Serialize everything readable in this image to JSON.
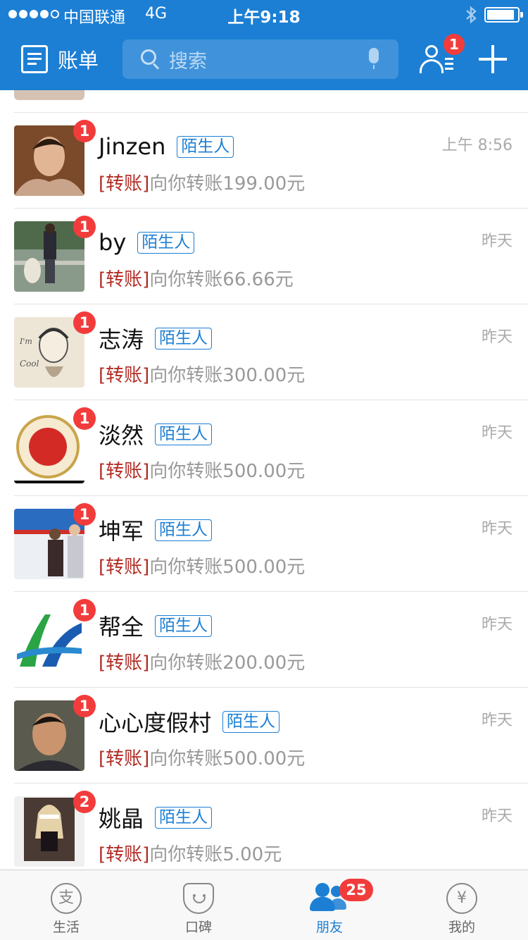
{
  "status_bar": {
    "carrier": "中国联通",
    "network": "4G",
    "time": "上午9:18",
    "bluetooth_icon": "bluetooth-icon",
    "battery_icon": "battery-icon"
  },
  "header": {
    "bill_label": "账单",
    "search_placeholder": "搜索",
    "contacts_badge": "1",
    "brand_color": "#1c7fd4"
  },
  "messages": [
    {
      "name": "Jinzen",
      "tag": "陌生人",
      "badge": "1",
      "kind": "[转账]",
      "text": "向你转账199.00元",
      "time": "上午 8:56"
    },
    {
      "name": "by",
      "tag": "陌生人",
      "badge": "1",
      "kind": "[转账]",
      "text": "向你转账66.66元",
      "time": "昨天"
    },
    {
      "name": "志涛",
      "tag": "陌生人",
      "badge": "1",
      "kind": "[转账]",
      "text": "向你转账300.00元",
      "time": "昨天"
    },
    {
      "name": "淡然",
      "tag": "陌生人",
      "badge": "1",
      "kind": "[转账]",
      "text": "向你转账500.00元",
      "time": "昨天"
    },
    {
      "name": "坤军",
      "tag": "陌生人",
      "badge": "1",
      "kind": "[转账]",
      "text": "向你转账500.00元",
      "time": "昨天"
    },
    {
      "name": "帮全",
      "tag": "陌生人",
      "badge": "1",
      "kind": "[转账]",
      "text": "向你转账200.00元",
      "time": "昨天"
    },
    {
      "name": "心心度假村",
      "tag": "陌生人",
      "badge": "1",
      "kind": "[转账]",
      "text": "向你转账500.00元",
      "time": "昨天"
    },
    {
      "name": "姚晶",
      "tag": "陌生人",
      "badge": "2",
      "kind": "[转账]",
      "text": "向你转账5.00元",
      "time": "昨天"
    }
  ],
  "tabbar": {
    "tabs": [
      {
        "label": "生活",
        "icon": "life-icon",
        "glyph": "支"
      },
      {
        "label": "口碑",
        "icon": "koubei-icon"
      },
      {
        "label": "朋友",
        "icon": "friends-icon",
        "badge": "25",
        "active": true
      },
      {
        "label": "我的",
        "icon": "wallet-icon",
        "glyph": "¥"
      }
    ]
  }
}
